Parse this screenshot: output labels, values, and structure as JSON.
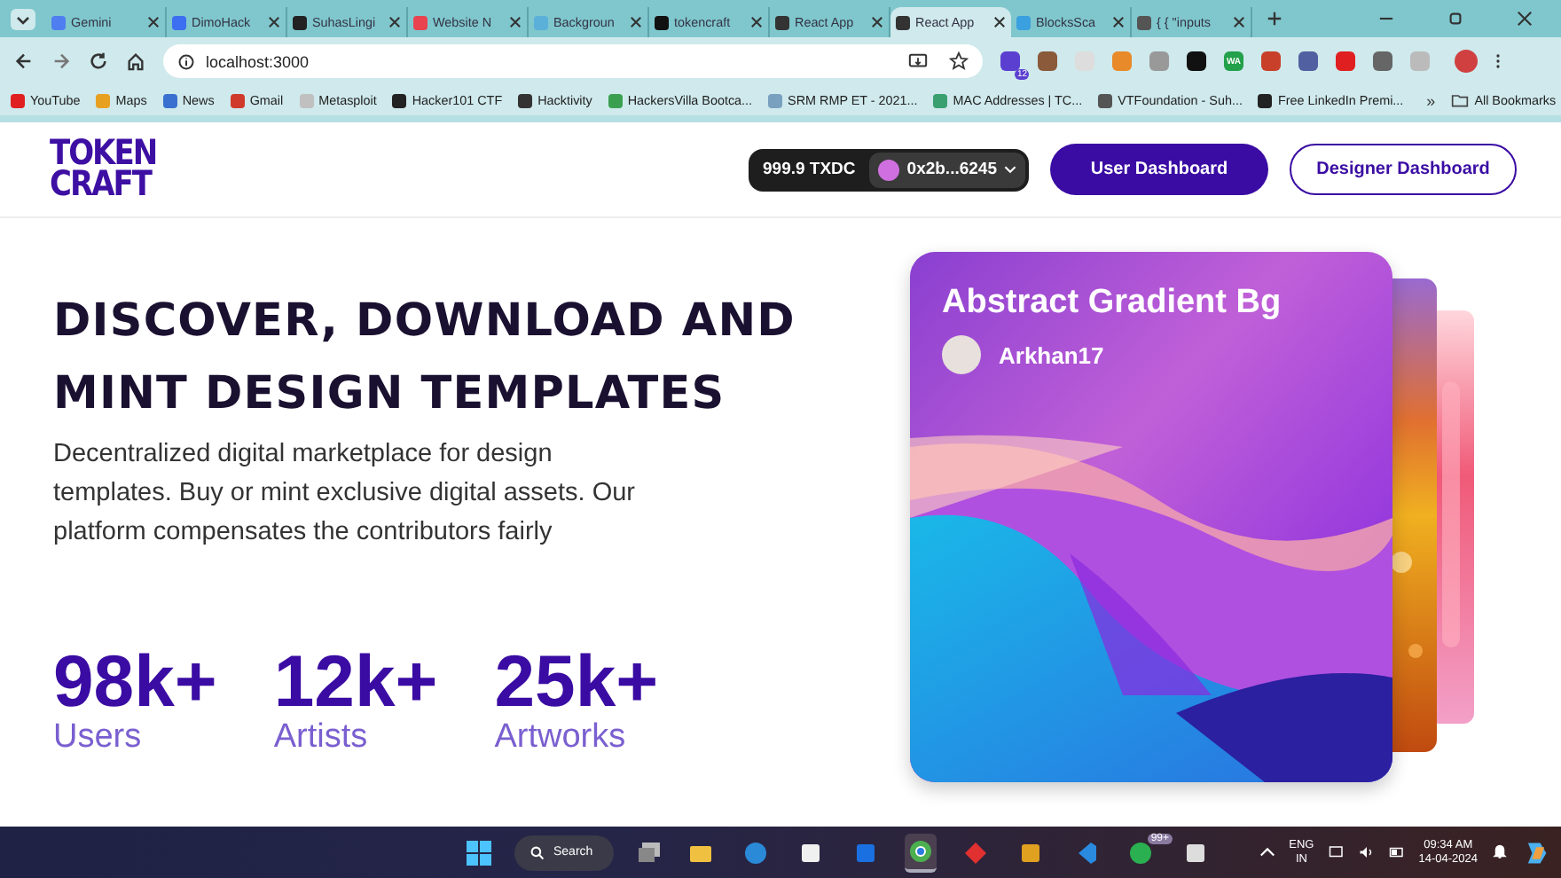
{
  "browser": {
    "tabs": [
      {
        "label": "Gemini",
        "color": "#4f7ef0",
        "selected": false
      },
      {
        "label": "DimoHack",
        "color": "#3b6ef0",
        "selected": false
      },
      {
        "label": "SuhasLingi",
        "color": "#222222",
        "selected": false
      },
      {
        "label": "Website N",
        "color": "#e8434f",
        "selected": false
      },
      {
        "label": "Backgroun",
        "color": "#5ab0d8",
        "selected": false
      },
      {
        "label": "tokencraft",
        "color": "#111111",
        "selected": false
      },
      {
        "label": "React App",
        "color": "#333333",
        "selected": false
      },
      {
        "label": "React App",
        "color": "#333333",
        "selected": true
      },
      {
        "label": "BlocksSca",
        "color": "#3aa0e0",
        "selected": false
      },
      {
        "label": "{ { \"inputs",
        "color": "#555555",
        "selected": false
      }
    ],
    "url": "localhost:3000",
    "extensions": [
      {
        "color": "#5b3fd0",
        "badge": "12"
      },
      {
        "color": "#8a5a3a"
      },
      {
        "color": "#dddddd"
      },
      {
        "color": "#e88a2a"
      },
      {
        "color": "#999999"
      },
      {
        "color": "#111111"
      },
      {
        "color": "#22a04a",
        "label": "WA"
      },
      {
        "color": "#c8402a"
      },
      {
        "color": "#5060a0"
      },
      {
        "color": "#e02020"
      },
      {
        "color": "#666666"
      },
      {
        "color": "#bbbbbb"
      }
    ],
    "bookmarks": [
      {
        "label": "YouTube",
        "color": "#e02020"
      },
      {
        "label": "Maps",
        "color": "#e8a020"
      },
      {
        "label": "News",
        "color": "#3a70d0"
      },
      {
        "label": "Gmail",
        "color": "#d03a2a"
      },
      {
        "label": "Metasploit",
        "color": "#c0c0c0"
      },
      {
        "label": "Hacker101 CTF",
        "color": "#222222"
      },
      {
        "label": "Hacktivity",
        "color": "#333333"
      },
      {
        "label": "HackersVilla Bootca...",
        "color": "#3aa050"
      },
      {
        "label": "SRM RMP ET - 2021...",
        "color": "#7aa0c0"
      },
      {
        "label": "MAC Addresses | TC...",
        "color": "#3aa070"
      },
      {
        "label": "VTFoundation - Suh...",
        "color": "#555555"
      },
      {
        "label": "Free LinkedIn Premi...",
        "color": "#222222"
      }
    ],
    "more": "»",
    "all_bookmarks": "All Bookmarks"
  },
  "site": {
    "logo": [
      "TOKEN",
      "CRAFT"
    ],
    "balance": "999.9 TXDC",
    "address": "0x2b...6245",
    "buttons": [
      {
        "label": "User Dashboard",
        "kind": "filled"
      },
      {
        "label": "Designer Dashboard",
        "kind": "outline"
      }
    ],
    "heading": [
      "DISCOVER, DOWNLOAD AND",
      "MINT DESIGN TEMPLATES"
    ],
    "description": "Decentralized digital marketplace for design templates. Buy or mint exclusive digital assets. Our platform compensates the contributors fairly",
    "stats": [
      {
        "value": "98k+",
        "label": "Users"
      },
      {
        "value": "12k+",
        "label": "Artists"
      },
      {
        "value": "25k+",
        "label": "Artworks"
      }
    ],
    "card": {
      "title": "Abstract Gradient Bg",
      "author": "Arkhan17"
    }
  },
  "taskbar": {
    "search": "Search",
    "apps": [
      {
        "color": "#f0c040",
        "kind": "folder",
        "selected": false
      },
      {
        "color": "#2a8ad8",
        "kind": "edge",
        "selected": false
      },
      {
        "color": "#f0f0f0",
        "kind": "store",
        "selected": false
      },
      {
        "color": "#1a70e0",
        "kind": "box",
        "selected": false
      },
      {
        "color": "#4caf50",
        "kind": "chrome",
        "selected": true
      },
      {
        "color": "#e03030",
        "kind": "diamond",
        "selected": false
      },
      {
        "color": "#e0a020",
        "kind": "box",
        "selected": false
      },
      {
        "color": "#2a8ae0",
        "kind": "code",
        "selected": false
      },
      {
        "color": "#2ab050",
        "kind": "chat",
        "selected": false,
        "badge": "99+"
      },
      {
        "color": "#dddddd",
        "kind": "store",
        "selected": false
      }
    ],
    "lang": [
      "ENG",
      "IN"
    ],
    "time": "09:34 AM",
    "date": "14-04-2024"
  }
}
